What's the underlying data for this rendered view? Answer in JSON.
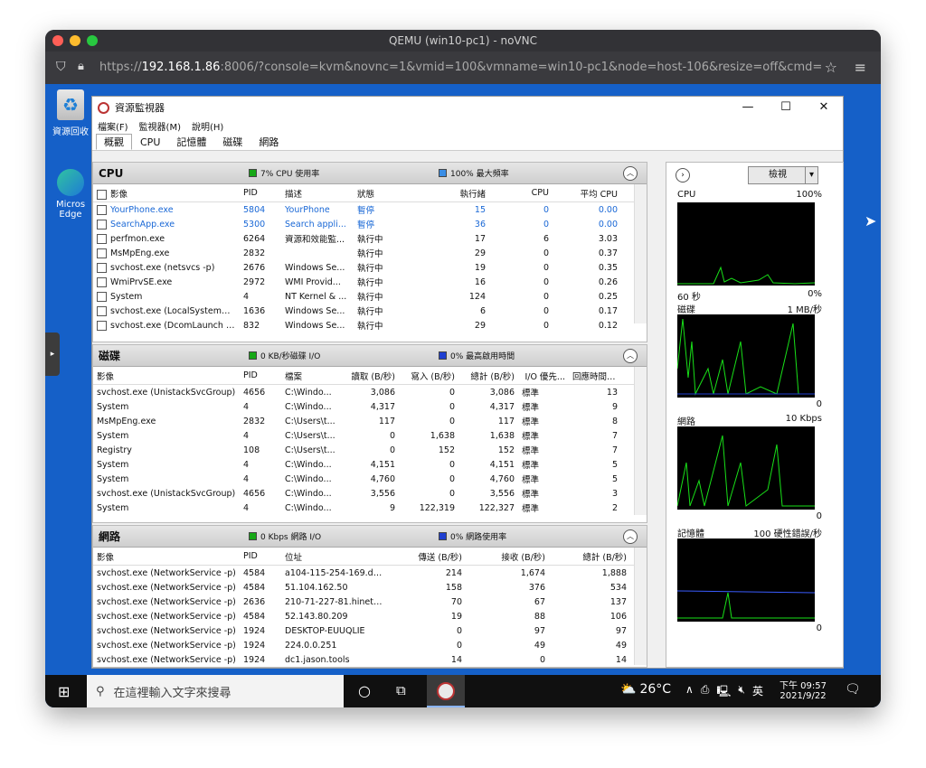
{
  "window": {
    "title": "QEMU (win10-pc1) - noVNC"
  },
  "url": {
    "prefix": "https://",
    "host": "192.168.1.86",
    "rest": ":8006/?console=kvm&novnc=1&vmid=100&vmname=win10-pc1&node=host-106&resize=off&cmd="
  },
  "desktop": {
    "recycle": "資源回收",
    "edge1": "Micros",
    "edge2": "Edge"
  },
  "rm": {
    "title": "資源監視器",
    "menu": [
      "檔案(F)",
      "監視器(M)",
      "說明(H)"
    ],
    "tabs": [
      "概觀",
      "CPU",
      "記憶體",
      "磁碟",
      "網路"
    ],
    "controls": {
      "min": "—",
      "max": "☐",
      "close": "✕"
    }
  },
  "cpu": {
    "title": "CPU",
    "m1": "7% CPU 使用率",
    "m2": "100% 最大頻率",
    "headers": [
      "影像",
      "PID",
      "描述",
      "狀態",
      "執行緒",
      "CPU",
      "平均 CPU"
    ],
    "rows": [
      [
        "YourPhone.exe",
        "5804",
        "YourPhone",
        "暫停",
        "15",
        "0",
        "0.00"
      ],
      [
        "SearchApp.exe",
        "5300",
        "Search appli...",
        "暫停",
        "36",
        "0",
        "0.00"
      ],
      [
        "perfmon.exe",
        "6264",
        "資源和效能監...",
        "執行中",
        "17",
        "6",
        "3.03"
      ],
      [
        "MsMpEng.exe",
        "2832",
        "",
        "執行中",
        "29",
        "0",
        "0.37"
      ],
      [
        "svchost.exe (netsvcs -p)",
        "2676",
        "Windows Se...",
        "執行中",
        "19",
        "0",
        "0.35"
      ],
      [
        "WmiPrvSE.exe",
        "2972",
        "WMI Provid...",
        "執行中",
        "16",
        "0",
        "0.26"
      ],
      [
        "System",
        "4",
        "NT Kernel & ...",
        "執行中",
        "124",
        "0",
        "0.25"
      ],
      [
        "svchost.exe (LocalSystemNe...",
        "1636",
        "Windows Se...",
        "執行中",
        "6",
        "0",
        "0.17"
      ],
      [
        "svchost.exe (DcomLaunch -p)",
        "832",
        "Windows Se...",
        "執行中",
        "29",
        "0",
        "0.12"
      ]
    ]
  },
  "disk": {
    "title": "磁碟",
    "m1": "0 KB/秒磁碟 I/O",
    "m2": "0% 最高啟用時間",
    "headers": [
      "影像",
      "PID",
      "檔案",
      "讀取 (B/秒)",
      "寫入 (B/秒)",
      "總計 (B/秒)",
      "I/O 優先...",
      "回應時間 (..."
    ],
    "rows": [
      [
        "svchost.exe (UnistackSvcGroup)",
        "4656",
        "C:\\Windo...",
        "3,086",
        "0",
        "3,086",
        "標準",
        "13"
      ],
      [
        "System",
        "4",
        "C:\\Windo...",
        "4,317",
        "0",
        "4,317",
        "標準",
        "9"
      ],
      [
        "MsMpEng.exe",
        "2832",
        "C:\\Users\\t...",
        "117",
        "0",
        "117",
        "標準",
        "8"
      ],
      [
        "System",
        "4",
        "C:\\Users\\t...",
        "0",
        "1,638",
        "1,638",
        "標準",
        "7"
      ],
      [
        "Registry",
        "108",
        "C:\\Users\\t...",
        "0",
        "152",
        "152",
        "標準",
        "7"
      ],
      [
        "System",
        "4",
        "C:\\Windo...",
        "4,151",
        "0",
        "4,151",
        "標準",
        "5"
      ],
      [
        "System",
        "4",
        "C:\\Windo...",
        "4,760",
        "0",
        "4,760",
        "標準",
        "5"
      ],
      [
        "svchost.exe (UnistackSvcGroup)",
        "4656",
        "C:\\Windo...",
        "3,556",
        "0",
        "3,556",
        "標準",
        "3"
      ],
      [
        "System",
        "4",
        "C:\\Windo...",
        "9",
        "122,319",
        "122,327",
        "標準",
        "2"
      ]
    ]
  },
  "net": {
    "title": "網路",
    "m1": "0 Kbps 網路 I/O",
    "m2": "0% 網路使用率",
    "headers": [
      "影像",
      "PID",
      "位址",
      "傳送 (B/秒)",
      "接收 (B/秒)",
      "總計 (B/秒)"
    ],
    "rows": [
      [
        "svchost.exe (NetworkService -p)",
        "4584",
        "a104-115-254-169.de...",
        "214",
        "1,674",
        "1,888"
      ],
      [
        "svchost.exe (NetworkService -p)",
        "4584",
        "51.104.162.50",
        "158",
        "376",
        "534"
      ],
      [
        "svchost.exe (NetworkService -p)",
        "2636",
        "210-71-227-81.hinet-...",
        "70",
        "67",
        "137"
      ],
      [
        "svchost.exe (NetworkService -p)",
        "4584",
        "52.143.80.209",
        "19",
        "88",
        "106"
      ],
      [
        "svchost.exe (NetworkService -p)",
        "1924",
        "DESKTOP-EUUQLIE",
        "0",
        "97",
        "97"
      ],
      [
        "svchost.exe (NetworkService -p)",
        "1924",
        "224.0.0.251",
        "0",
        "49",
        "49"
      ],
      [
        "svchost.exe (NetworkService -p)",
        "1924",
        "dc1.jason.tools",
        "14",
        "0",
        "14"
      ]
    ]
  },
  "graphs": {
    "view_label": "檢視",
    "cpu": {
      "name": "CPU",
      "max": "100%",
      "left": "60 秒",
      "right": "0%"
    },
    "disk": {
      "name": "磁碟",
      "max": "1 MB/秒",
      "zero": "0"
    },
    "net": {
      "name": "網路",
      "max": "10 Kbps",
      "zero": "0"
    },
    "mem": {
      "name": "記憶體",
      "max": "100 硬性錯誤/秒",
      "zero": "0"
    }
  },
  "taskbar": {
    "search": "在這裡輸入文字來搜尋",
    "weather": "26°C",
    "ime": "英",
    "time": "下午 09:57",
    "date": "2021/9/22"
  },
  "colors": {
    "green": "#17a817",
    "blue": "#1f3fd1"
  }
}
